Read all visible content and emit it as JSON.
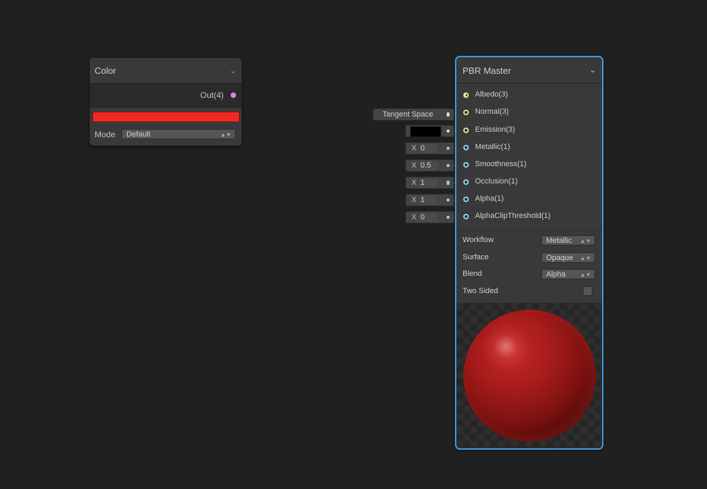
{
  "color_node": {
    "title": "Color",
    "output_label": "Out(4)",
    "color_value": "#f02a22",
    "mode_label": "Mode",
    "mode_value": "Default"
  },
  "pbr_node": {
    "title": "PBR Master",
    "inputs": [
      {
        "label": "Albedo(3)",
        "port_color": "#e8e49c"
      },
      {
        "label": "Normal(3)",
        "port_color": "#e8e49c"
      },
      {
        "label": "Emission(3)",
        "port_color": "#e8e49c"
      },
      {
        "label": "Metallic(1)",
        "port_color": "#8ad7ee"
      },
      {
        "label": "Smoothness(1)",
        "port_color": "#8ad7ee"
      },
      {
        "label": "Occlusion(1)",
        "port_color": "#8ad7ee"
      },
      {
        "label": "Alpha(1)",
        "port_color": "#8ad7ee"
      },
      {
        "label": "AlphaClipThreshold(1)",
        "port_color": "#8ad7ee"
      }
    ],
    "options": {
      "workflow_label": "Workflow",
      "workflow_value": "Metallic",
      "surface_label": "Surface",
      "surface_value": "Opaque",
      "blend_label": "Blend",
      "blend_value": "Alpha",
      "two_sided_label": "Two Sided"
    }
  },
  "default_fields": {
    "normal_space": "Tangent Space",
    "emission_color": "#000000",
    "axis_letter": "X",
    "metallic": "0",
    "smoothness": "0.5",
    "occlusion": "1",
    "alpha": "1",
    "alpha_clip_threshold": "0"
  },
  "colors": {
    "background": "#202020",
    "node_body": "#393939",
    "selection_outline": "#3f9de0",
    "vector_port": "#e8e49c",
    "float_port": "#8ad7ee",
    "color_out_port": "#e47ce0",
    "albedo_sphere": "#a81c1b"
  }
}
